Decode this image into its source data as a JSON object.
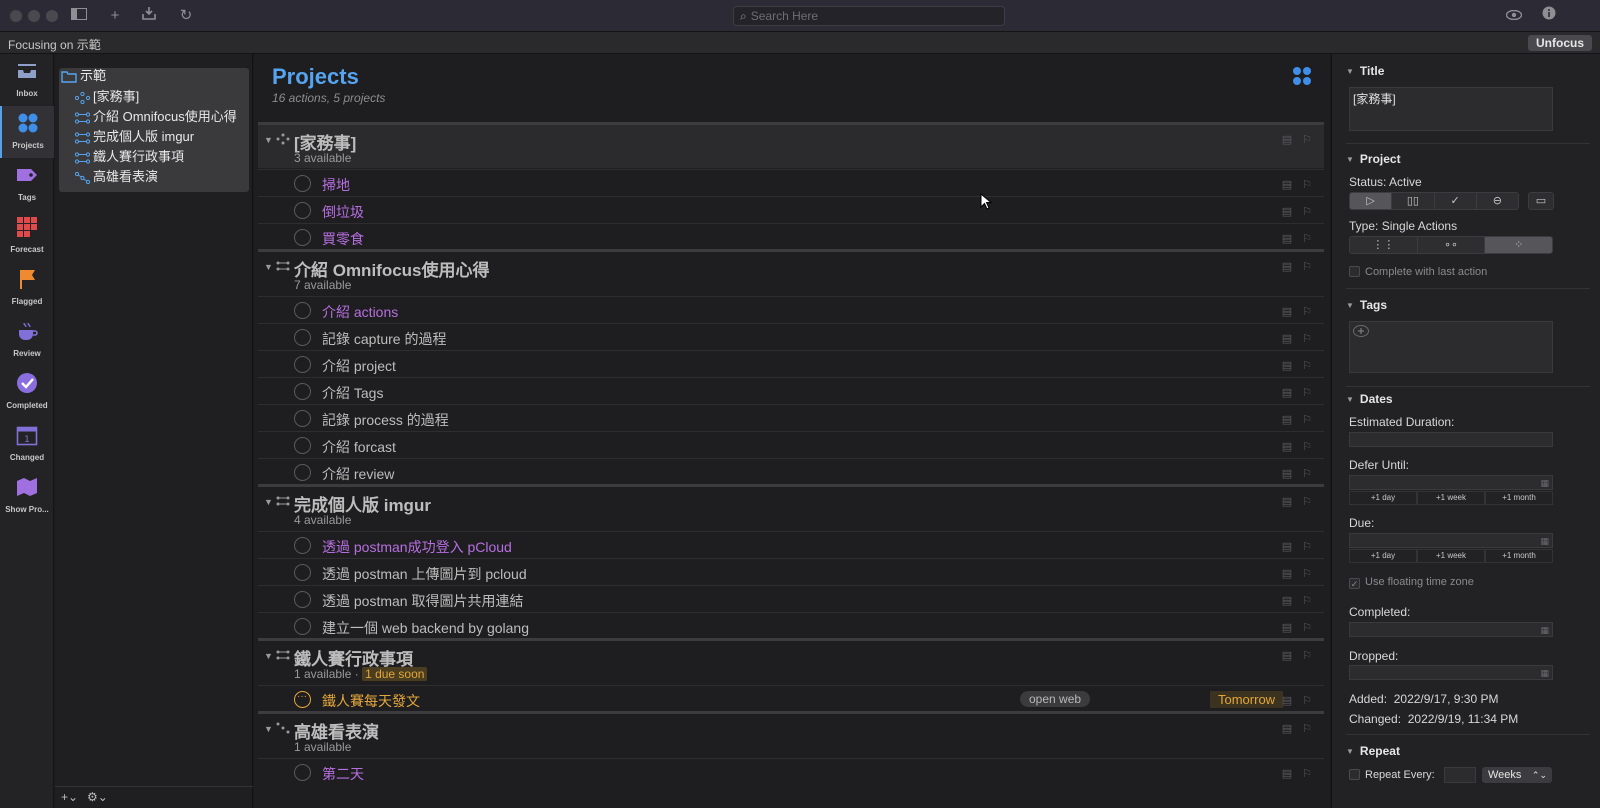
{
  "toolbar": {
    "search_placeholder": "Search Here"
  },
  "focus": {
    "text": "Focusing on 示範",
    "unfocus_label": "Unfocus"
  },
  "perspectives": [
    {
      "label": "Inbox",
      "icon": "inbox-icon",
      "color": "#8fa0c8"
    },
    {
      "label": "Projects",
      "icon": "projects-icon",
      "color": "#3f8ee8"
    },
    {
      "label": "Tags",
      "icon": "tag-icon",
      "color": "#a070e0"
    },
    {
      "label": "Forecast",
      "icon": "forecast-icon",
      "color": "#e04a4a"
    },
    {
      "label": "Flagged",
      "icon": "flag-icon",
      "color": "#f08a30"
    },
    {
      "label": "Review",
      "icon": "review-icon",
      "color": "#8070d8"
    },
    {
      "label": "Completed",
      "icon": "completed-icon",
      "color": "#8a6ee0"
    },
    {
      "label": "Changed",
      "icon": "changed-icon",
      "color": "#8070d8"
    },
    {
      "label": "Show Pro...",
      "icon": "show-projects-icon",
      "color": "#a070e0"
    }
  ],
  "sidebar": {
    "folder": "示範",
    "items": [
      "[家務事]",
      "介紹 Omnifocus使用心得",
      "完成個人版 imgur",
      "鐵人賽行政事項",
      "高雄看表演"
    ]
  },
  "main": {
    "title": "Projects",
    "subtitle": "16 actions, 5 projects",
    "projects": [
      {
        "title": "[家務事]",
        "available": "3 available",
        "tasks": [
          {
            "title": "掃地",
            "state": "avail"
          },
          {
            "title": "倒垃圾",
            "state": "avail"
          },
          {
            "title": "買零食",
            "state": "avail"
          }
        ]
      },
      {
        "title": "介紹 Omnifocus使用心得",
        "available": "7 available",
        "tasks": [
          {
            "title": "介紹 actions",
            "state": "avail"
          },
          {
            "title": "記錄 capture 的過程",
            "state": "normal"
          },
          {
            "title": "介紹 project",
            "state": "normal"
          },
          {
            "title": "介紹 Tags",
            "state": "normal"
          },
          {
            "title": "記錄 process 的過程",
            "state": "normal"
          },
          {
            "title": "介紹 forcast",
            "state": "normal"
          },
          {
            "title": "介紹 review",
            "state": "normal"
          }
        ]
      },
      {
        "title": "完成個人版 imgur",
        "available": "4 available",
        "tasks": [
          {
            "title": "透過 postman成功登入 pCloud",
            "state": "avail"
          },
          {
            "title": "透過 postman 上傳圖片到 pcloud",
            "state": "normal"
          },
          {
            "title": "透過 postman 取得圖片共用連結",
            "state": "normal"
          },
          {
            "title": "建立一個 web backend by golang",
            "state": "normal"
          }
        ]
      },
      {
        "title": "鐵人賽行政事項",
        "available": "1 available ·",
        "due_soon": "1 due soon",
        "tasks": [
          {
            "title": "鐵人賽每天發文",
            "state": "due",
            "tag": "open web",
            "date": "Tomorrow"
          }
        ]
      },
      {
        "title": "高雄看表演",
        "available": "1 available",
        "tasks": [
          {
            "title": "第二天",
            "state": "avail"
          }
        ]
      }
    ]
  },
  "inspector": {
    "title_section": "Title",
    "title_value": "[家務事]",
    "project_section": "Project",
    "status_label": "Status:",
    "status_value": "Active",
    "type_label": "Type:",
    "type_value": "Single Actions",
    "complete_last": "Complete with last action",
    "tags_section": "Tags",
    "dates_section": "Dates",
    "est_duration": "Estimated Duration:",
    "defer_until": "Defer Until:",
    "due": "Due:",
    "quick": [
      "+1 day",
      "+1 week",
      "+1 month"
    ],
    "floating_tz": "Use floating time zone",
    "completed": "Completed:",
    "dropped": "Dropped:",
    "added_label": "Added:",
    "added_value": "2022/9/17, 9:30 PM",
    "changed_label": "Changed:",
    "changed_value": "2022/9/19, 11:34 PM",
    "repeat_section": "Repeat",
    "repeat_every": "Repeat Every:",
    "repeat_unit": "Weeks"
  }
}
